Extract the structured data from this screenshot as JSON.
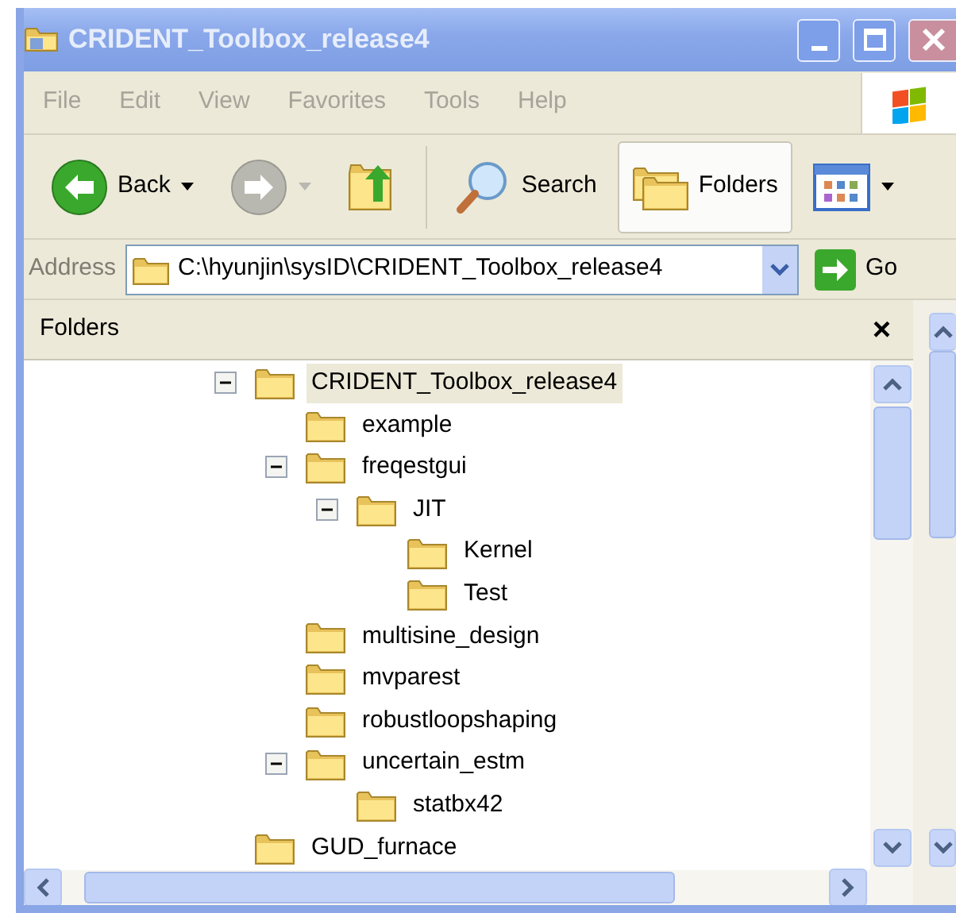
{
  "window": {
    "title": "CRIDENT_Toolbox_release4"
  },
  "menu": [
    "File",
    "Edit",
    "View",
    "Favorites",
    "Tools",
    "Help"
  ],
  "toolbar": [
    {
      "kind": "back",
      "label": "Back",
      "selected": false,
      "disabled": false
    },
    {
      "kind": "forward",
      "selected": false,
      "disabled": true
    },
    {
      "kind": "up",
      "selected": false,
      "disabled": false
    },
    {
      "kind": "search",
      "label": "Search",
      "selected": false,
      "disabled": false
    },
    {
      "kind": "folders",
      "label": "Folders",
      "selected": true,
      "disabled": false
    },
    {
      "kind": "views",
      "selected": false,
      "disabled": false
    }
  ],
  "address": {
    "label": "Address",
    "value": "C:\\hyunjin\\sysID\\CRIDENT_Toolbox_release4",
    "go": "Go"
  },
  "folders_pane": {
    "title": "Folders",
    "close": "×",
    "tree": [
      {
        "label": "CRIDENT_Toolbox_release4",
        "selected": true,
        "expanded": true,
        "children": [
          {
            "label": "example",
            "selected": false
          },
          {
            "label": "freqestgui",
            "selected": false,
            "expanded": true,
            "children": [
              {
                "label": "JIT",
                "selected": false,
                "expanded": true,
                "children": [
                  {
                    "label": "Kernel",
                    "selected": false
                  },
                  {
                    "label": "Test",
                    "selected": false
                  }
                ]
              }
            ]
          },
          {
            "label": "multisine_design",
            "selected": false
          },
          {
            "label": "mvparest",
            "selected": false
          },
          {
            "label": "robustloopshaping",
            "selected": false
          },
          {
            "label": "uncertain_estm",
            "selected": false,
            "expanded": true,
            "children": [
              {
                "label": "statbx42",
                "selected": false
              }
            ]
          }
        ]
      },
      {
        "label": "GUD_furnace",
        "selected": false
      }
    ]
  }
}
